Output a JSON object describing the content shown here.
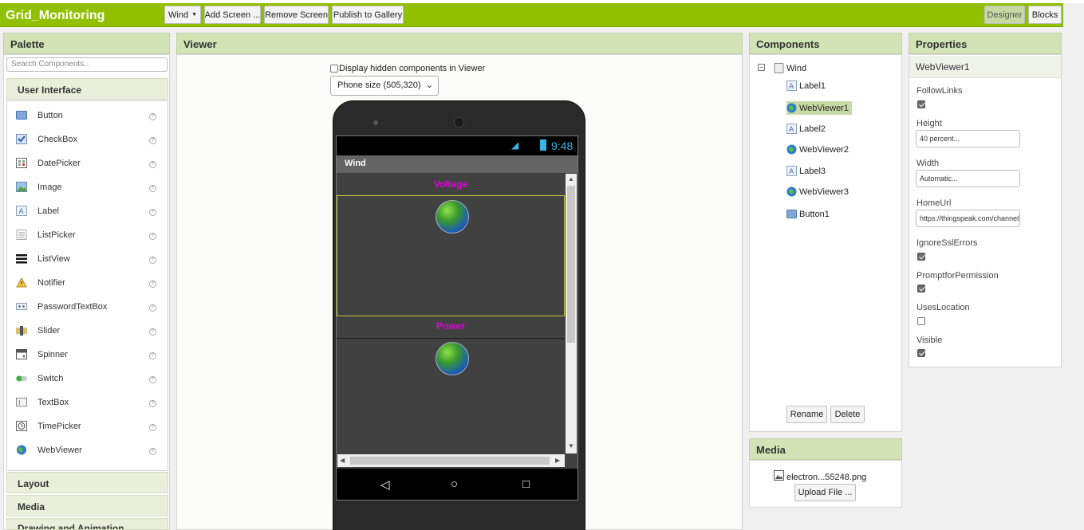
{
  "app": {
    "title": "Grid_Monitoring"
  },
  "toolbar": {
    "screen_select": "Wind",
    "add_screen": "Add Screen ...",
    "remove_screen": "Remove Screen",
    "publish": "Publish to Gallery",
    "designer": "Designer",
    "blocks": "Blocks"
  },
  "palette": {
    "title": "Palette",
    "search_placeholder": "Search Components...",
    "category_user_interface": "User Interface",
    "items": [
      {
        "label": "Button",
        "icon": "button-icon"
      },
      {
        "label": "CheckBox",
        "icon": "checkbox-icon"
      },
      {
        "label": "DatePicker",
        "icon": "datepicker-icon"
      },
      {
        "label": "Image",
        "icon": "image-icon"
      },
      {
        "label": "Label",
        "icon": "label-icon"
      },
      {
        "label": "ListPicker",
        "icon": "listpicker-icon"
      },
      {
        "label": "ListView",
        "icon": "listview-icon"
      },
      {
        "label": "Notifier",
        "icon": "notifier-icon"
      },
      {
        "label": "PasswordTextBox",
        "icon": "password-icon"
      },
      {
        "label": "Slider",
        "icon": "slider-icon"
      },
      {
        "label": "Spinner",
        "icon": "spinner-icon"
      },
      {
        "label": "Switch",
        "icon": "switch-icon"
      },
      {
        "label": "TextBox",
        "icon": "textbox-icon"
      },
      {
        "label": "TimePicker",
        "icon": "timepicker-icon"
      },
      {
        "label": "WebViewer",
        "icon": "webviewer-icon"
      }
    ],
    "help_glyph": "?",
    "category_layout": "Layout",
    "category_media": "Media",
    "category_drawing": "Drawing and Animation"
  },
  "viewer": {
    "title": "Viewer",
    "hidden_checkbox_label": "Display hidden components in Viewer",
    "hidden_checked": false,
    "size_select": "Phone size (505,320)",
    "phone": {
      "time": "9:48",
      "screen_title": "Wind",
      "label1": "Voltage",
      "label2": "Power"
    }
  },
  "components": {
    "title": "Components",
    "root": "Wind",
    "items": [
      "Label1",
      "WebViewer1",
      "Label2",
      "WebViewer2",
      "Label3",
      "WebViewer3",
      "Button1"
    ],
    "selected": "WebViewer1",
    "rename": "Rename",
    "delete": "Delete"
  },
  "media": {
    "title": "Media",
    "file": "electron...55248.png",
    "upload": "Upload File ..."
  },
  "properties": {
    "title": "Properties",
    "component": "WebViewer1",
    "follow_links_label": "FollowLinks",
    "follow_links": true,
    "height_label": "Height",
    "height_value": "40 percent...",
    "width_label": "Width",
    "width_value": "Automatic...",
    "homeurl_label": "HomeUrl",
    "homeurl_value": "https://thingspeak.com/channels",
    "ignore_ssl_label": "IgnoreSslErrors",
    "ignore_ssl": true,
    "prompt_label": "PromptforPermission",
    "prompt": true,
    "uses_location_label": "UsesLocation",
    "uses_location": false,
    "visible_label": "Visible",
    "visible": true
  },
  "colors": {
    "topbar": "#90c000",
    "panel_header": "#d4e3b6",
    "selection": "#c7d9a5",
    "label_magenta": "#e000e0",
    "status_clock": "#39b4e6"
  }
}
